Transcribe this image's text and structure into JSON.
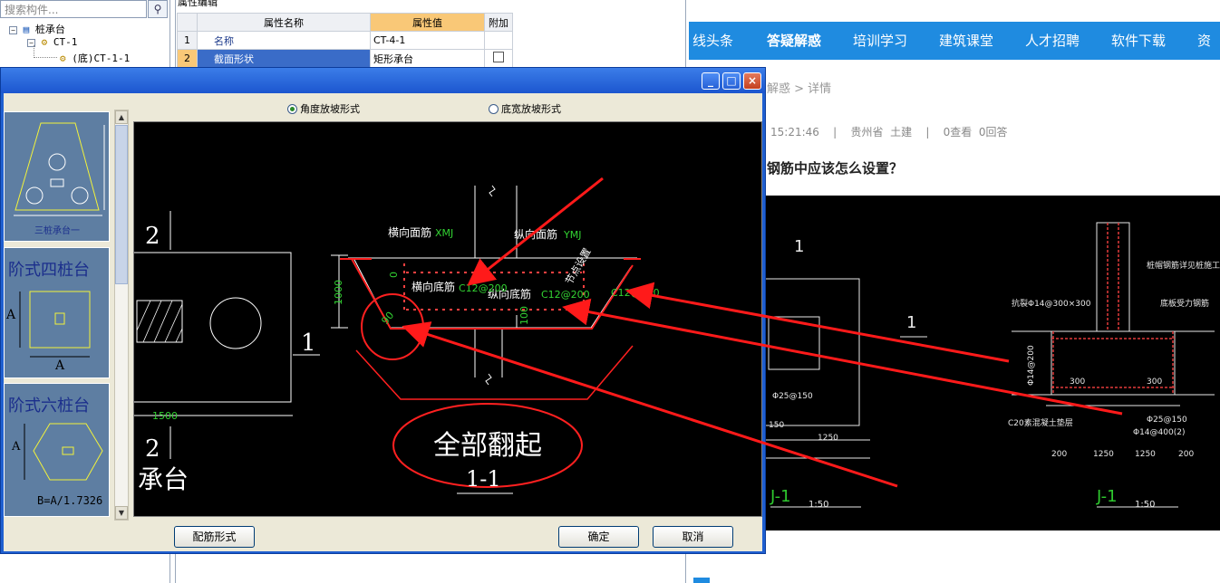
{
  "left_panel": {
    "search_placeholder": "搜索构件...",
    "tree": {
      "root": {
        "expander": "−",
        "label": "桩承台"
      },
      "child": {
        "expander": "−",
        "label": "CT-1"
      },
      "leaf": {
        "label": "(底)CT-1-1"
      }
    }
  },
  "property_panel": {
    "title": "属性编辑",
    "headers": {
      "name": "属性名称",
      "value": "属性值",
      "extra": "附加"
    },
    "rows": [
      {
        "no": "1",
        "name": "名称",
        "value": "CT-4-1"
      },
      {
        "no": "2",
        "name": "截面形状",
        "value": "矩形承台"
      }
    ]
  },
  "website": {
    "nav": [
      "线头条",
      "答疑解惑",
      "培训学习",
      "建筑课堂",
      "人才招聘",
      "软件下载",
      "资料"
    ],
    "active_nav": "答疑解惑",
    "breadcrumb": "解惑 > 详情",
    "meta": "15:21:46    |    贵州省  土建    |    0查看  0回答",
    "question_title": "钢筋中应该怎么设置？",
    "cad": {
      "label_top_1": "1",
      "label_mid_1": "1",
      "dia_left": "Φ25@150",
      "dim_1250": "1250",
      "dim_150": "150",
      "title_left": "J-1",
      "scale_left": "1:50",
      "title_right": "J-1",
      "scale_right": "1:50",
      "note_top": "桩帽钢筋详见桩施工图",
      "note_grid": "抗裂Φ14@300×300",
      "note_bottom_rebar": "底板受力钢筋",
      "note_phi14": "Φ14@200",
      "note_300a": "300",
      "note_300b": "300",
      "note_phi25": "Φ25@150",
      "note_c20": "C20素混凝土垫层",
      "note_phi14b": "Φ14@400(2)",
      "dim_200a": "200",
      "dim_1250a": "1250",
      "dim_1250b": "1250",
      "dim_200b": "200"
    }
  },
  "dialog": {
    "buttons": {
      "min": "_",
      "max": "□",
      "close": "×"
    },
    "radio_angle": "角度放坡形式",
    "radio_bottom": "底宽放坡形式",
    "selected_radio": "角度放坡形式",
    "thumbs": {
      "t1_caption": "三桩承台一",
      "t2_title": "阶式四桩台",
      "t2_dim_a": "A",
      "t2_dim_b": "A",
      "t3_title": "阶式六桩台",
      "t3_dim": "A",
      "t3_formula": "B=A/1.7326"
    },
    "drawing": {
      "label_2_top": "2",
      "label_1": "1",
      "label_2_bottom": "2",
      "label_chengtai": "承台",
      "dim_1500": "1500",
      "dim_1000": "1000",
      "dim_0": "0",
      "dim_100": "100",
      "angle_90": "90",
      "lbl_hm": "横向面筋",
      "code_xmj": "XMJ",
      "lbl_zm": "纵向面筋",
      "code_ymj": "YMJ",
      "lbl_hd": "横向底筋",
      "code_hd": "C12@200",
      "lbl_zd": "纵向底筋",
      "code_zd": "C12@200",
      "code_right": "C12@200",
      "slant_text": "节点设置",
      "annotation": "全部翻起",
      "section_label": "1-1"
    },
    "bottom_left_button": "配筋形式",
    "ok_button": "确定",
    "cancel_button": "取消"
  },
  "colors": {
    "nav_blue": "#1f8be0",
    "title_blue": "#1f5fd0",
    "annotation_red": "#ff0000",
    "rebar_green": "#32d232"
  }
}
